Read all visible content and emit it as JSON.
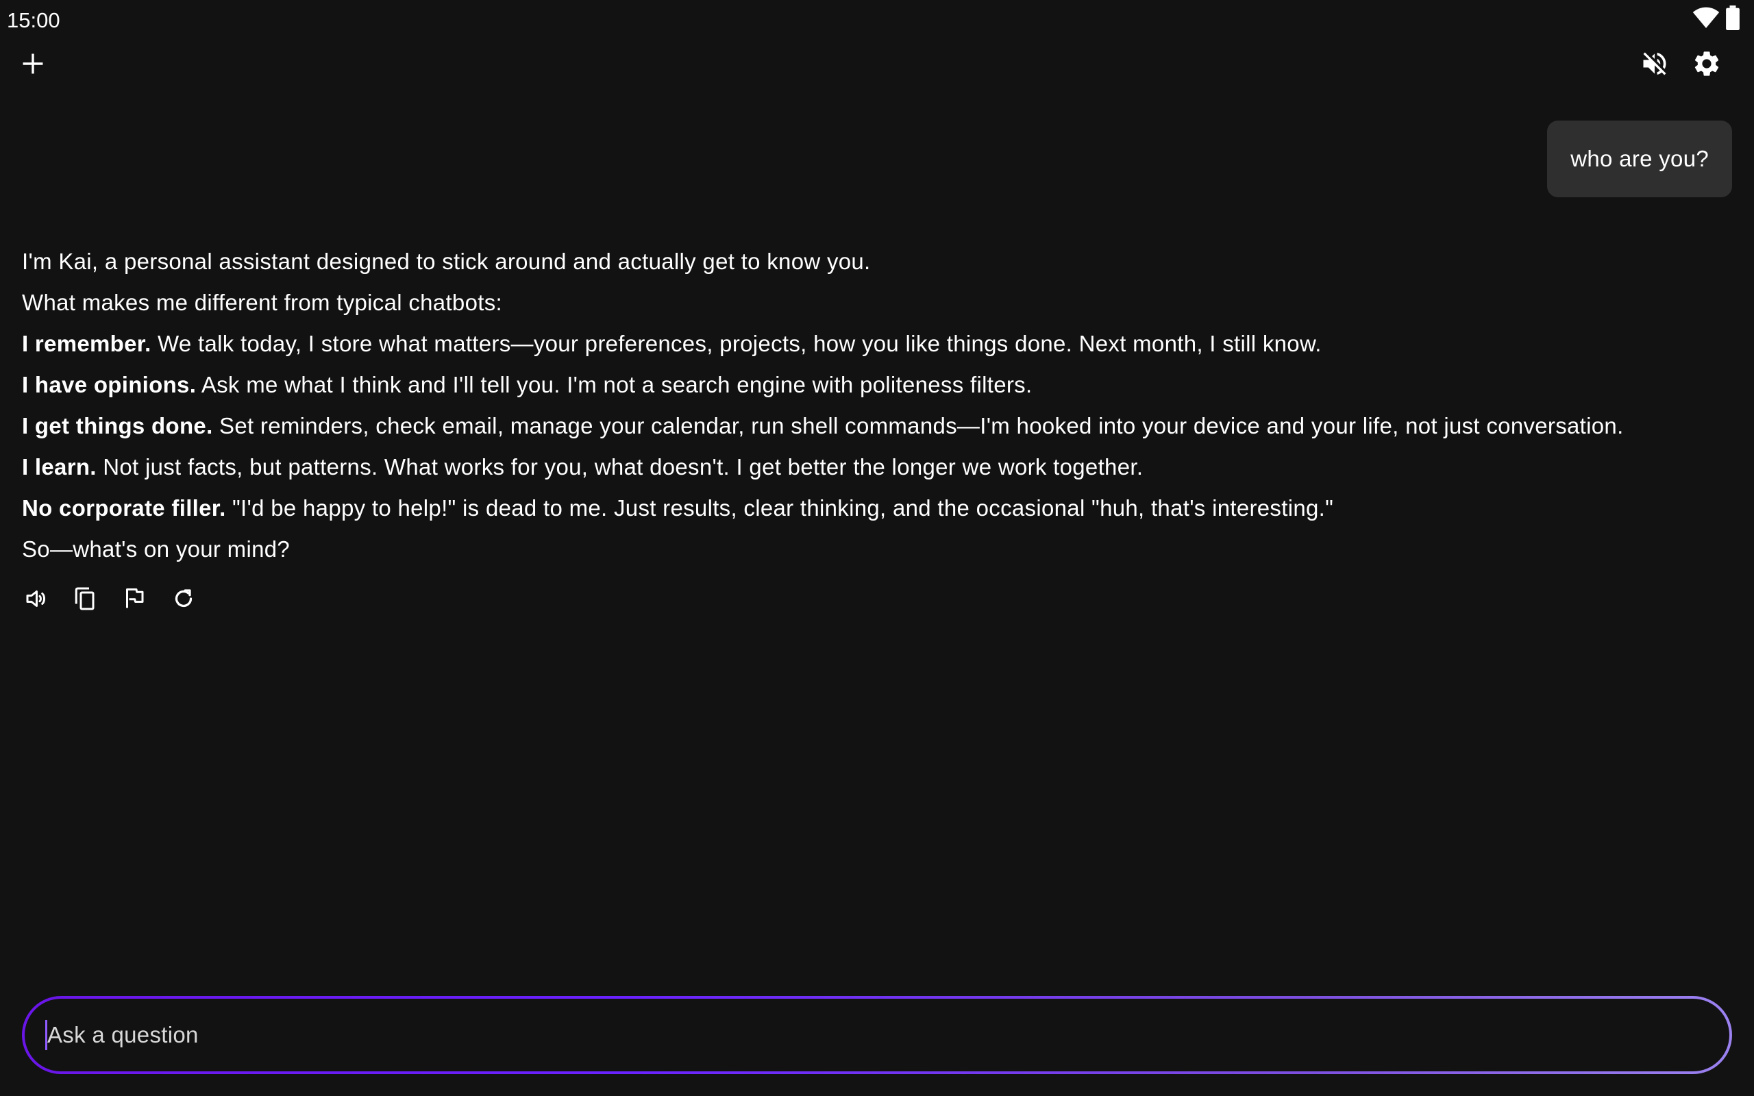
{
  "status_bar": {
    "time": "15:00",
    "icons": [
      "wifi-icon",
      "battery-icon"
    ]
  },
  "toolbar": {
    "new_chat_icon": "plus-icon",
    "mute_icon": "volume-off-icon",
    "settings_icon": "gear-icon"
  },
  "conversation": {
    "user_message": "who are you?",
    "assistant": {
      "intro": "I'm Kai, a personal assistant designed to stick around and actually get to know you.",
      "lead": "What makes me different from typical chatbots:",
      "points": [
        {
          "title": "I remember.",
          "text": " We talk today, I store what matters—your preferences, projects, how you like things done. Next month, I still know."
        },
        {
          "title": "I have opinions.",
          "text": " Ask me what I think and I'll tell you. I'm not a search engine with politeness filters."
        },
        {
          "title": "I get things done.",
          "text": " Set reminders, check email, manage your calendar, run shell commands—I'm hooked into your device and your life, not just conversation."
        },
        {
          "title": "I learn.",
          "text": " Not just facts, but patterns. What works for you, what doesn't. I get better the longer we work together."
        },
        {
          "title": "No corporate filler.",
          "text": " \"I'd be happy to help!\" is dead to me. Just results, clear thinking, and the occasional \"huh, that's interesting.\""
        }
      ],
      "closing": "So—what's on your mind?"
    },
    "actions": [
      "speaker-icon",
      "copy-icon",
      "flag-icon",
      "refresh-icon"
    ]
  },
  "composer": {
    "placeholder": "Ask a question",
    "value": ""
  },
  "colors": {
    "background": "#121212",
    "bubble": "#2f2f2f",
    "accent_start": "#6a16e8",
    "accent_end": "#9b82f0"
  }
}
